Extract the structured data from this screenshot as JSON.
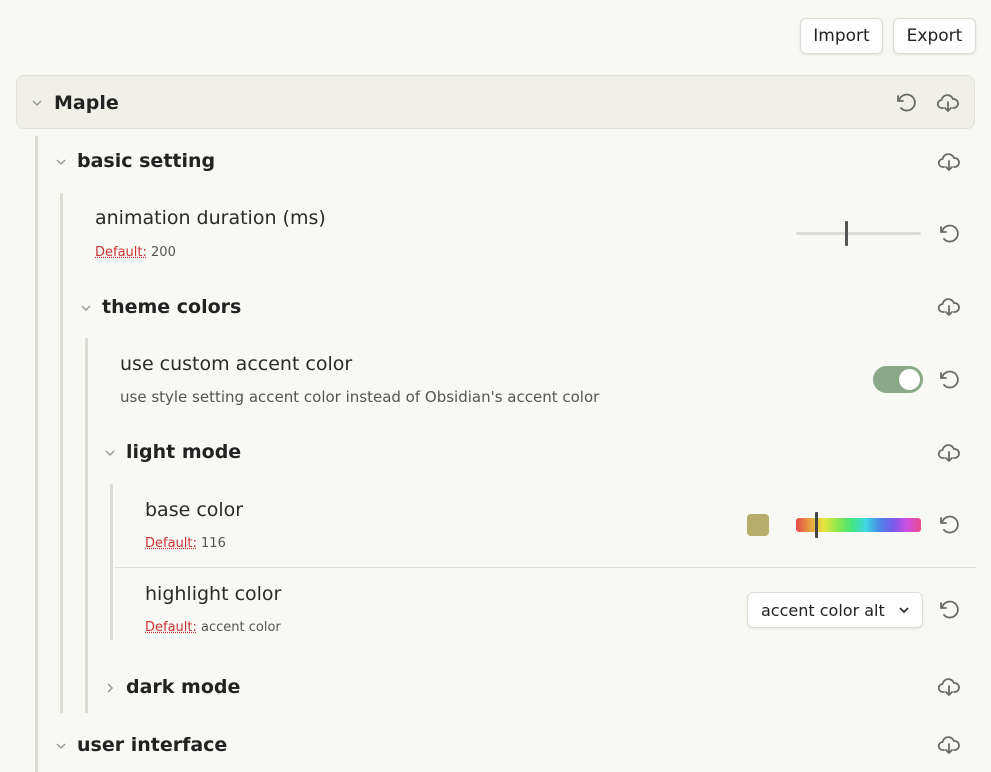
{
  "toolbar": {
    "import_label": "Import",
    "export_label": "Export"
  },
  "plugin": {
    "title": "Maple"
  },
  "sections": {
    "basic": {
      "title": "basic setting",
      "animation": {
        "name": "animation duration (ms)",
        "default_label": "Default:",
        "default_value": "200",
        "slider_value": 200
      },
      "theme_colors": {
        "title": "theme colors",
        "custom_accent": {
          "name": "use custom accent color",
          "description": "use style setting accent color instead of Obsidian's accent color",
          "enabled": true
        },
        "light_mode": {
          "title": "light mode",
          "base_color": {
            "name": "base color",
            "default_label": "Default:",
            "default_value": "116",
            "swatch_color": "#b5ad6b"
          },
          "highlight_color": {
            "name": "highlight color",
            "default_label": "Default:",
            "default_value": "accent color",
            "selected": "accent color alt"
          }
        },
        "dark_mode": {
          "title": "dark mode"
        }
      }
    },
    "ui": {
      "title": "user interface"
    }
  },
  "colors": {
    "accent": "#8ba888",
    "default_red": "#cc3333"
  }
}
